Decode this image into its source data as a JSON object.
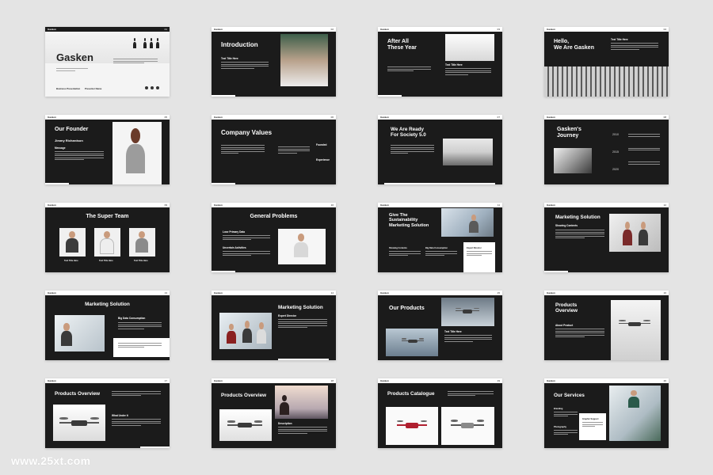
{
  "brand": "Gasken",
  "watermark": "www.25xt.com",
  "slides": {
    "s1": {
      "title": "Gasken",
      "num": "01",
      "footer_left": "Business Presentation",
      "footer_right": "Presenter Name"
    },
    "s2": {
      "title": "Introduction",
      "num": "02",
      "sub": "Text Title Here"
    },
    "s3": {
      "title": "After All\nThese Year",
      "num": "03",
      "sub": "Text Title Here"
    },
    "s4": {
      "title": "Hello,\nWe Are Gasken",
      "num": "04",
      "sub": "Text Title Here"
    },
    "s5": {
      "title": "Our Founder",
      "num": "05",
      "name": "Jimmy Richardson",
      "sub": "Message"
    },
    "s6": {
      "title": "Company Values",
      "num": "06",
      "sub1": "Founded",
      "sub2": "Experience"
    },
    "s7": {
      "title": "We Are Ready\nFor Society 5.0",
      "num": "07"
    },
    "s8": {
      "title": "Gasken's\nJourney",
      "num": "08",
      "years": [
        "2010",
        "2015",
        "2020"
      ]
    },
    "s9": {
      "title": "The Super Team",
      "num": "09",
      "names": [
        "Text Title Here",
        "Text Title Here",
        "Text Title Here"
      ]
    },
    "s10": {
      "title": "General Problems",
      "num": "10",
      "sub1": "Lose Primary Data",
      "sub2": "Uncertain Activities"
    },
    "s11": {
      "title": "Give The\nSustainability\nMarketing Solution",
      "num": "11",
      "sub1": "Showing Contents",
      "sub2": "Big Data Consumption",
      "sub3": "Expert Director"
    },
    "s12": {
      "title": "Marketing Solution",
      "num": "12",
      "sub": "Showing Contents"
    },
    "s13": {
      "title": "Marketing Solution",
      "num": "13",
      "sub": "Big Data Consumption"
    },
    "s14": {
      "title": "Marketing Solution",
      "num": "14",
      "sub": "Expert Director"
    },
    "s15": {
      "title": "Our Products",
      "num": "15",
      "sub": "Text Title Here"
    },
    "s16": {
      "title": "Products\nOverview",
      "num": "16",
      "sub": "About Product"
    },
    "s17": {
      "title": "Products Overview",
      "num": "17",
      "sub": "What Under It"
    },
    "s18": {
      "title": "Products Overview",
      "num": "18",
      "sub": "Description"
    },
    "s19": {
      "title": "Products Catalogue",
      "num": "19"
    },
    "s20": {
      "title": "Our Services",
      "num": "20",
      "sub1": "Branding",
      "sub2": "Graphic Support",
      "sub3": "Photography"
    }
  }
}
